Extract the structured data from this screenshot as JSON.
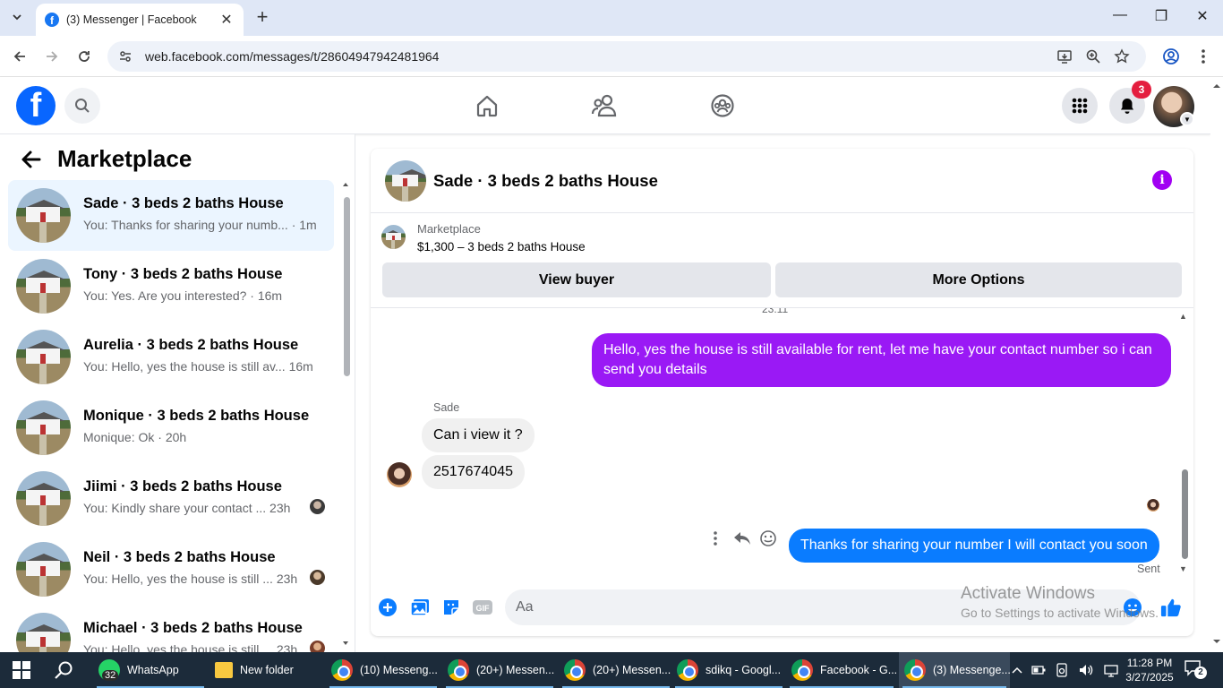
{
  "browser": {
    "tab_title": "(3) Messenger | Facebook",
    "url": "web.facebook.com/messages/t/28604947942481964"
  },
  "header": {
    "notification_count": "3"
  },
  "sidebar": {
    "title": "Marketplace",
    "conversations": [
      {
        "name": "Sade · 3 beds 2 baths House",
        "snippet": "You: Thanks for sharing your numb... · 1m",
        "active": true
      },
      {
        "name": "Tony · 3 beds 2 baths House",
        "snippet": "You: Yes. Are you interested? · 16m"
      },
      {
        "name": "Aurelia · 3 beds 2 baths House",
        "snippet": "You: Hello, yes the house is still av...  16m"
      },
      {
        "name": "Monique · 3 beds 2 baths House",
        "snippet": "Monique: Ok · 20h"
      },
      {
        "name": "Jiimi · 3 beds 2 baths House",
        "snippet": "You: Kindly share your contact ...   23h"
      },
      {
        "name": "Neil · 3 beds 2 baths House",
        "snippet": "You: Hello, yes the house is still ...  23h"
      },
      {
        "name": "Michael · 3 beds 2 baths House",
        "snippet": "You: Hello, yes the house is still ...  23h"
      }
    ]
  },
  "chat": {
    "title": "Sade · 3 beds 2 baths House",
    "listing": {
      "source": "Marketplace",
      "price_title": "$1,300 – 3 beds 2 baths House",
      "view_buyer_label": "View buyer",
      "more_options_label": "More Options"
    },
    "timestamp": "23:11",
    "messages": [
      {
        "from": "me",
        "text": "Hello, yes the house is still available for rent, let me have your contact number so i can send you  details"
      },
      {
        "from": "Sade",
        "text": "Can i view it ?"
      },
      {
        "from": "Sade",
        "text": "2517674045"
      },
      {
        "from": "me",
        "text": "Thanks for sharing your number I will contact you soon"
      }
    ],
    "sender_label": "Sade",
    "sent_label": "Sent",
    "composer_placeholder": "Aa"
  },
  "watermark": {
    "line1": "Activate Windows",
    "line2": "Go to Settings to activate Windows."
  },
  "taskbar": {
    "items": [
      {
        "label": "WhatsApp",
        "badge": "32"
      },
      {
        "label": "New folder"
      },
      {
        "label": "(10) Messeng..."
      },
      {
        "label": "(20+) Messen..."
      },
      {
        "label": "(20+) Messen..."
      },
      {
        "label": "sdikq - Googl..."
      },
      {
        "label": "Facebook - G..."
      },
      {
        "label": "(3) Messenge..."
      }
    ],
    "time": "11:28 PM",
    "date": "3/27/2025",
    "notification_badge": "2"
  },
  "colors": {
    "facebook_blue": "#0866ff",
    "purple_bubble": "#9a19f5",
    "blue_bubble": "#0a7cff",
    "info_purple": "#a100f2",
    "notification_red": "#e41e3f"
  }
}
